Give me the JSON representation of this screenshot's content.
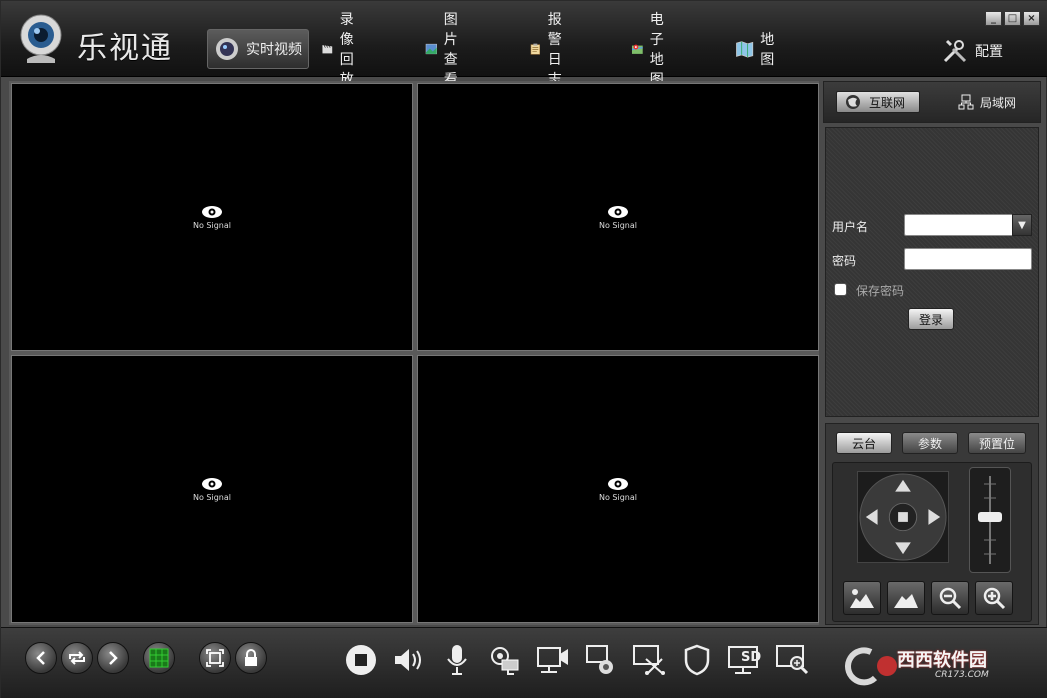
{
  "app": {
    "title": "乐视通",
    "window_controls": [
      "minimize",
      "maximize",
      "close"
    ]
  },
  "nav": [
    {
      "label": "实时视频",
      "icon": "webcam-icon",
      "active": true
    },
    {
      "label": "录像回放",
      "icon": "clapperboard-icon",
      "active": false
    },
    {
      "label": "图片查看",
      "icon": "picture-icon",
      "active": false
    },
    {
      "label": "报警日志",
      "icon": "clipboard-icon",
      "active": false
    },
    {
      "label": "电子地图",
      "icon": "map-pin-icon",
      "active": false
    },
    {
      "label": "地图",
      "icon": "folded-map-icon",
      "active": false
    }
  ],
  "config": {
    "label": "配置",
    "icon": "tools-icon"
  },
  "video": {
    "panes": [
      {
        "status": "No Signal"
      },
      {
        "status": "No Signal"
      },
      {
        "status": "No Signal"
      },
      {
        "status": "No Signal"
      }
    ]
  },
  "network_tabs": [
    {
      "label": "互联网",
      "icon": "globe-icon",
      "active": true
    },
    {
      "label": "局域网",
      "icon": "lan-icon",
      "active": false
    }
  ],
  "login": {
    "username_label": "用户名",
    "username_value": "",
    "password_label": "密码",
    "password_value": "",
    "save_password_label": "保存密码",
    "save_password_checked": false,
    "login_button": "登录"
  },
  "ptz": {
    "tabs": [
      {
        "label": "云台",
        "active": true
      },
      {
        "label": "参数",
        "active": false
      },
      {
        "label": "预置位",
        "active": false
      }
    ],
    "buttons": [
      "focus-near-icon",
      "focus-far-icon",
      "zoom-out-icon",
      "zoom-in-icon"
    ]
  },
  "toolbar": {
    "left": [
      "prev-icon",
      "loop-icon",
      "next-icon",
      "grid-layout-icon",
      "fullscreen-icon",
      "lock-icon"
    ],
    "right": [
      "stop-icon",
      "volume-icon",
      "microphone-icon",
      "camera-settings-icon",
      "record-icon",
      "capture-icon",
      "crop-icon",
      "shield-icon",
      "sd-card-icon",
      "zoom-view-icon"
    ]
  },
  "watermark": {
    "brand": "西西软件园",
    "url": "CR173.COM"
  },
  "colors": {
    "background": "#4a4a4a",
    "video_bg": "#000000",
    "accent": "#c03030"
  }
}
